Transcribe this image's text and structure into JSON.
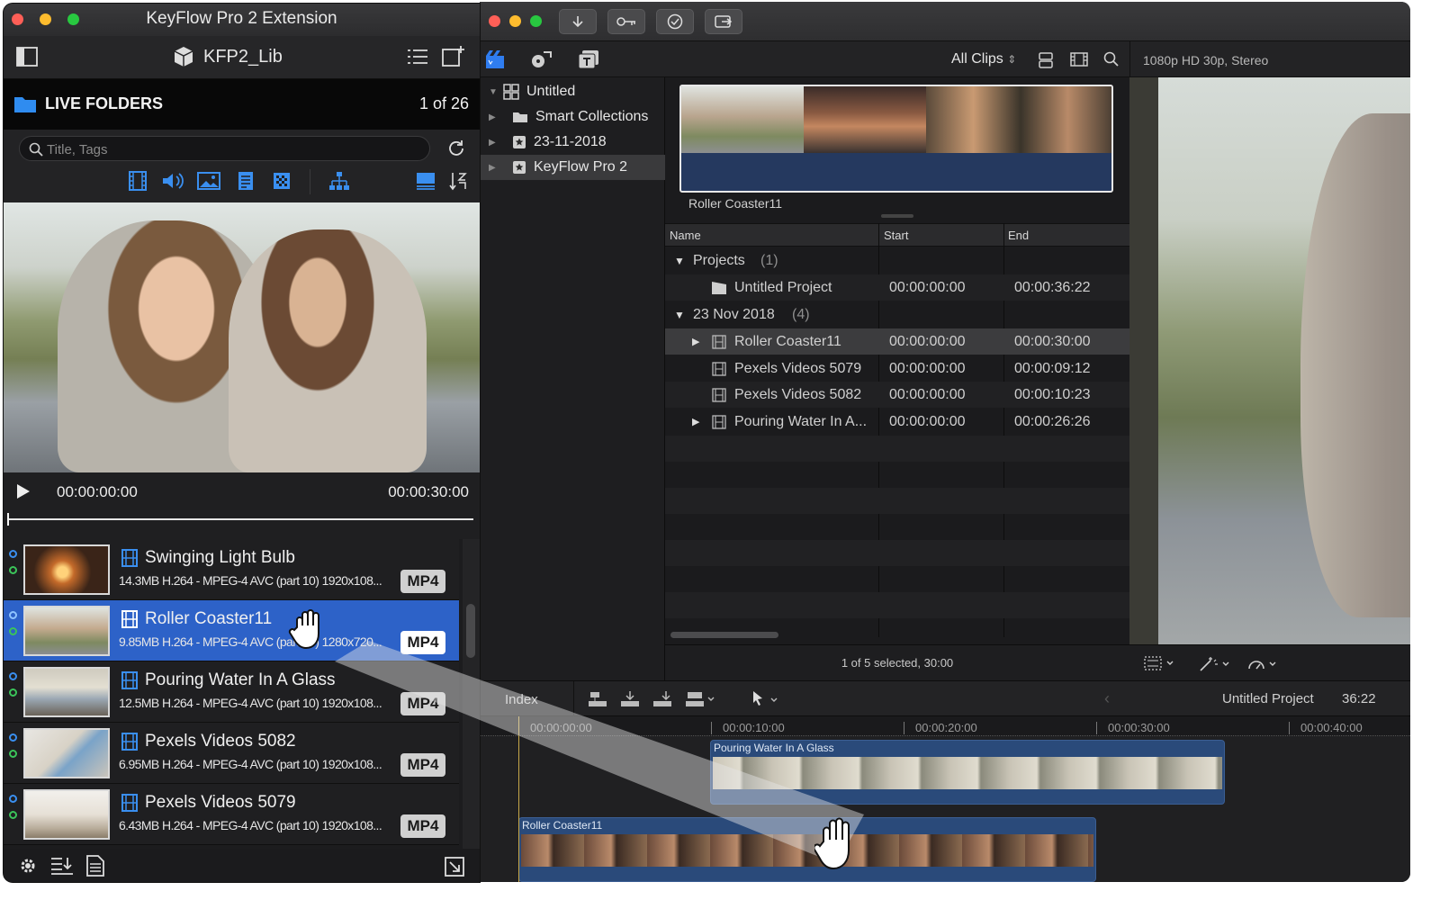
{
  "plugin": {
    "title": "KeyFlow Pro 2 Extension",
    "library_name": "KFP2_Lib",
    "folders_label": "LIVE FOLDERS",
    "folders_count": "1 of 26",
    "search_placeholder": "Title, Tags",
    "timecode_start": "00:00:00:00",
    "timecode_end": "00:00:30:00",
    "clips": [
      {
        "title": "Swinging Light Bulb",
        "info": "14.3MB H.264 - MPEG-4 AVC (part 10) 1920x108...",
        "format": "MP4"
      },
      {
        "title": "Roller Coaster11",
        "info": "9.85MB H.264 - MPEG-4 AVC (part 10) 1280x720...",
        "format": "MP4"
      },
      {
        "title": "Pouring Water In A Glass",
        "info": "12.5MB H.264 - MPEG-4 AVC (part 10) 1920x108...",
        "format": "MP4"
      },
      {
        "title": "Pexels Videos 5082",
        "info": "6.95MB H.264 - MPEG-4 AVC (part 10) 1920x108...",
        "format": "MP4"
      },
      {
        "title": "Pexels Videos 5079",
        "info": "6.43MB H.264 - MPEG-4 AVC (part 10) 1920x108...",
        "format": "MP4"
      }
    ]
  },
  "fcp": {
    "filter": "All Clips",
    "viewer_format": "1080p HD 30p, Stereo",
    "libraries": [
      {
        "name": "Untitled"
      },
      {
        "name": "Smart Collections"
      },
      {
        "name": "23-11-2018"
      },
      {
        "name": "KeyFlow Pro 2"
      }
    ],
    "filmstrip_label": "Roller Coaster11",
    "columns": {
      "name": "Name",
      "start": "Start",
      "end": "End"
    },
    "groups": [
      {
        "name": "Projects",
        "count": "(1)"
      },
      {
        "name": "23 Nov 2018",
        "count": "(4)"
      }
    ],
    "items": [
      {
        "name": "Untitled Project",
        "start": "00:00:00:00",
        "end": "00:00:36:22"
      },
      {
        "name": "Roller Coaster11",
        "start": "00:00:00:00",
        "end": "00:00:30:00"
      },
      {
        "name": "Pexels Videos 5079",
        "start": "00:00:00:00",
        "end": "00:00:09:12"
      },
      {
        "name": "Pexels Videos 5082",
        "start": "00:00:00:00",
        "end": "00:00:10:23"
      },
      {
        "name": "Pouring Water In A...",
        "start": "00:00:00:00",
        "end": "00:00:26:26"
      }
    ],
    "selection_status": "1 of 5 selected, 30:00",
    "timeline": {
      "index_label": "Index",
      "project_name": "Untitled Project",
      "duration": "36:22",
      "ruler": [
        "00:00:00:00",
        "00:00:10:00",
        "00:00:20:00",
        "00:00:30:00",
        "00:00:40:00"
      ],
      "clip_upper": "Pouring Water In A Glass",
      "clip_lower": "Roller Coaster11"
    }
  },
  "colors": {
    "selection_blue": "#2d62c8",
    "folder_blue": "#2f8cf0",
    "clip_blue": "#2a4a7a",
    "playhead": "#c8a94a"
  }
}
